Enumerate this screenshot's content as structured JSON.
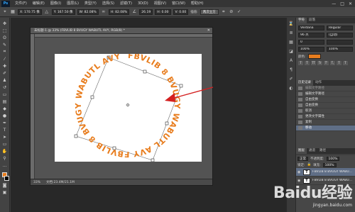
{
  "app": {
    "logo": "Ps",
    "menu": [
      "文件(F)",
      "编辑(E)",
      "图像(I)",
      "图层(L)",
      "类型(Y)",
      "选择(S)",
      "滤镜(T)",
      "3D(D)",
      "视图(V)",
      "窗口(W)",
      "帮助(H)"
    ],
    "window_controls": [
      "—",
      "□",
      "✕"
    ]
  },
  "options_bar": {
    "x_value": "X: 170.75 像",
    "y_value": "Y: 167.50 像",
    "w_value": "W: 82.08%",
    "h_value": "H: 82.08%",
    "angle_value": "26.19",
    "h_skew": "H: 0.00",
    "v_skew": "V: 0.00",
    "interp": "两次立方",
    "cancel_icon": "cancel-icon",
    "commit_icon": "check-icon"
  },
  "document": {
    "tab_title": "未标题-1 @ 33% (FBVLIB 8 BVUGY WABUTL AVY, RGB/8) *",
    "zoom": "33%",
    "doc_info": "文档:23.4M/21.1M",
    "circle_text": "FBVLIB 8 BVUGY WABUTL AVY FBVLIB 8 BVUGY WABUTL AVY",
    "text_color": "#e87d1e",
    "arrow_color": "#d42020"
  },
  "panels": {
    "char_tabs": [
      "字符",
      "段落"
    ],
    "font_family": "Verdana",
    "font_style": "Regular",
    "font_size": "96 点",
    "leading": "(自动)",
    "tracking": "0",
    "scale_v": "100%",
    "scale_h": "100%",
    "color_label": "颜色:",
    "style_buttons": [
      "T",
      "T",
      "TT",
      "Tr",
      "T'",
      "T,",
      "T",
      "T"
    ],
    "history_tabs": [
      "历史记录",
      "动作"
    ],
    "history_items": [
      {
        "label": "编辑文字路径",
        "state": "dim"
      },
      {
        "label": "编辑文字路径",
        "state": "normal"
      },
      {
        "label": "自由变换",
        "state": "normal"
      },
      {
        "label": "自由变换",
        "state": "normal"
      },
      {
        "label": "取消",
        "state": "normal"
      },
      {
        "label": "更改文字属性",
        "state": "normal"
      },
      {
        "label": "复制",
        "state": "normal"
      },
      {
        "label": "移动",
        "state": "active"
      }
    ],
    "layers_tabs": [
      "图层",
      "通道",
      "路径"
    ],
    "blend_mode": "正常",
    "opacity_label": "不透明度:",
    "opacity": "100%",
    "lock_label": "锁定:",
    "fill_label": "填充:",
    "fill": "100%",
    "layers": [
      {
        "name": "FBVLIB 8 BVUGY WABU...",
        "state": "active"
      },
      {
        "name": "FBVLIB 8 BVUGY WABU...",
        "state": "normal"
      }
    ]
  },
  "watermark": {
    "main": "Baidu经验",
    "sub": "jingyan.baidu.com"
  }
}
